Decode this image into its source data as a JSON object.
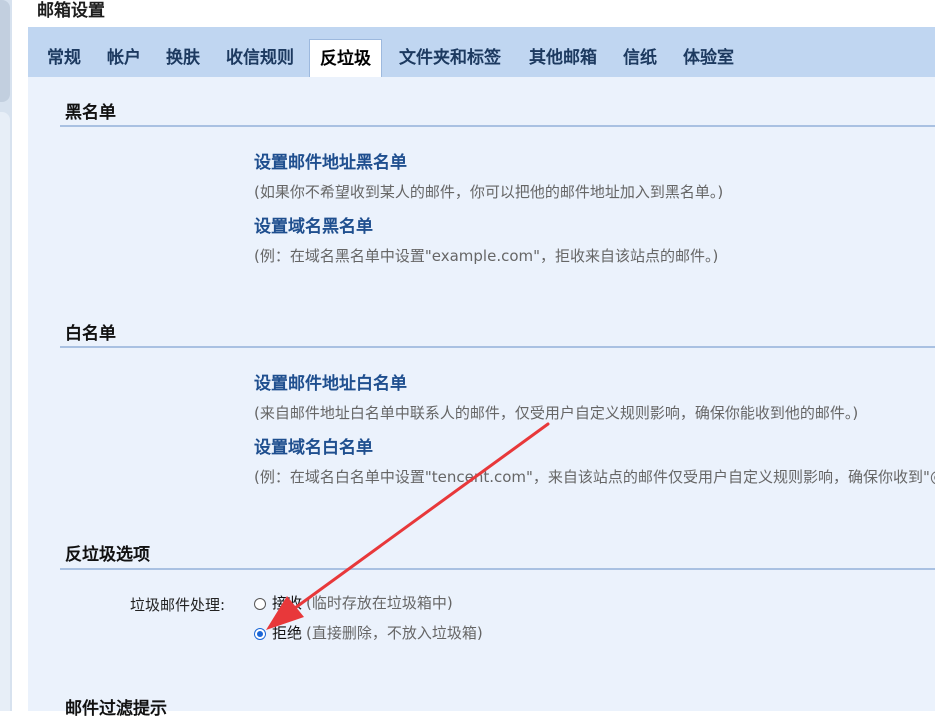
{
  "page": {
    "title": "邮箱设置"
  },
  "tabs": [
    {
      "label": "常规"
    },
    {
      "label": "帐户"
    },
    {
      "label": "换肤"
    },
    {
      "label": "收信规则"
    },
    {
      "label": "反垃圾",
      "active": true
    },
    {
      "label": "文件夹和标签"
    },
    {
      "label": "其他邮箱"
    },
    {
      "label": "信纸"
    },
    {
      "label": "体验室"
    }
  ],
  "blacklist": {
    "title": "黑名单",
    "address_link": "设置邮件地址黑名单",
    "address_hint": "(如果你不希望收到某人的邮件，你可以把他的邮件地址加入到黑名单。)",
    "domain_link": "设置域名黑名单",
    "domain_hint": "(例：在域名黑名单中设置\"example.com\"，拒收来自该站点的邮件。)"
  },
  "whitelist": {
    "title": "白名单",
    "address_link": "设置邮件地址白名单",
    "address_hint": "(来自邮件地址白名单中联系人的邮件，仅受用户自定义规则影响，确保你能收到他的邮件。)",
    "domain_link": "设置域名白名单",
    "domain_hint": "(例：在域名白名单中设置\"tencent.com\"，来自该站点的邮件仅受用户自定义规则影响，确保你收到\"@"
  },
  "antispam": {
    "title": "反垃圾选项",
    "handling_label": "垃圾邮件处理:",
    "options": [
      {
        "label": "接收",
        "note": "(临时存放在垃圾箱中)",
        "checked": false
      },
      {
        "label": "拒绝",
        "note": "(直接删除，不放入垃圾箱)",
        "checked": true
      }
    ]
  },
  "filter": {
    "title": "邮件过滤提示"
  },
  "annotation": {
    "arrow_color": "#e8383a"
  }
}
